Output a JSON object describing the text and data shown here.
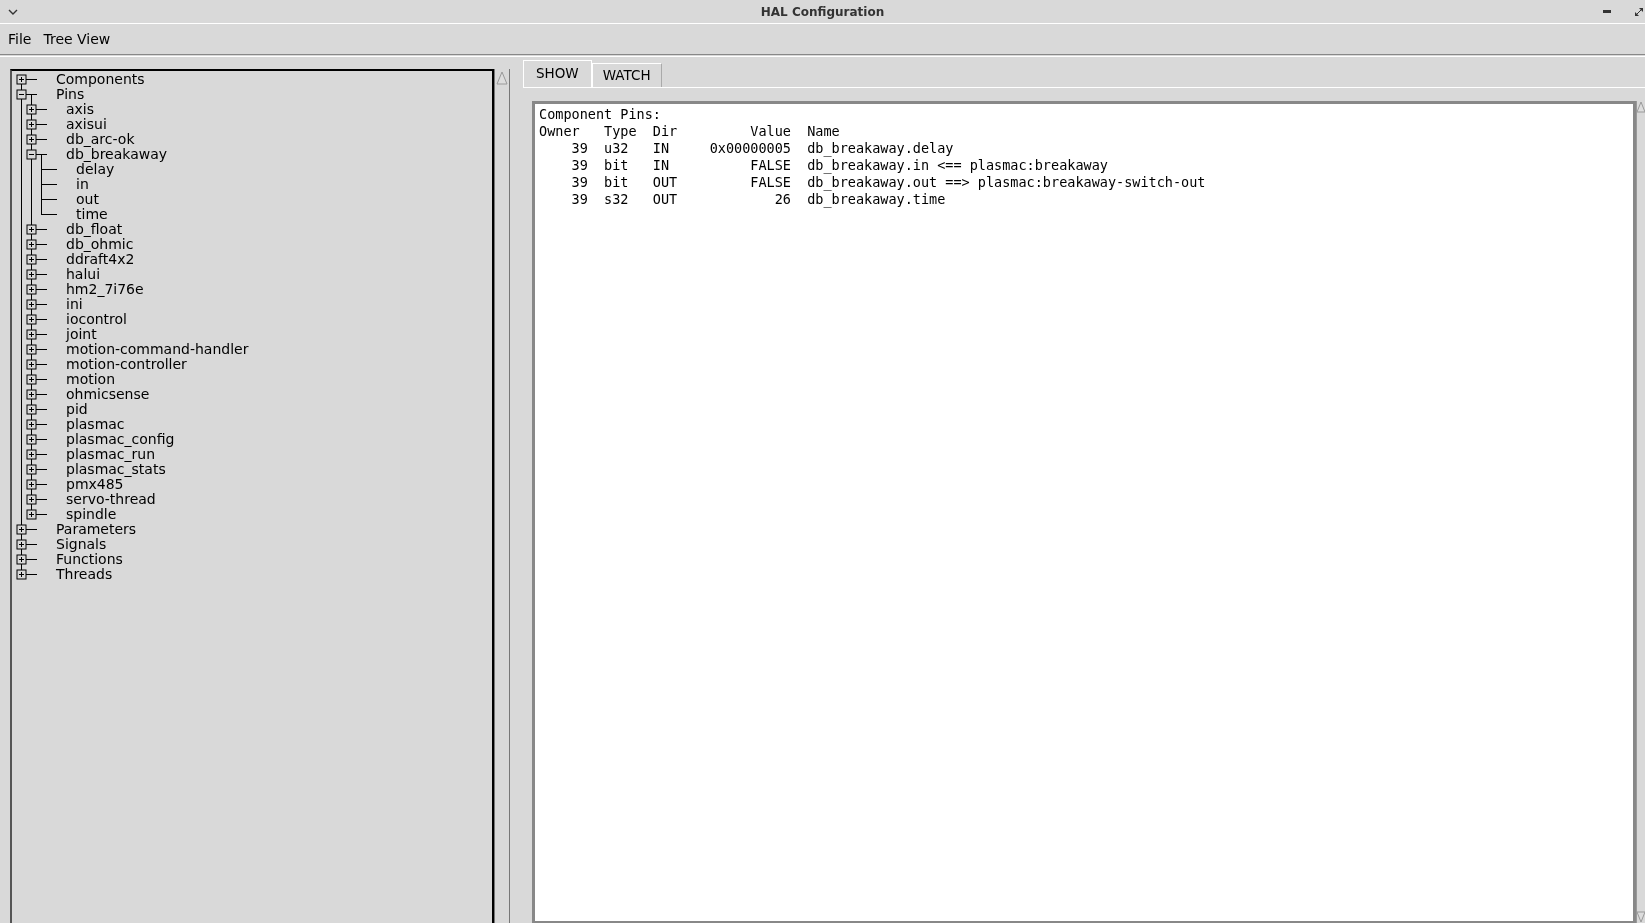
{
  "window": {
    "title": "HAL Configuration"
  },
  "menu": [
    "File",
    "Tree View"
  ],
  "tree": [
    {
      "label": "Components",
      "expanded": false
    },
    {
      "label": "Pins",
      "expanded": true,
      "children": [
        {
          "label": "axis",
          "expanded": false
        },
        {
          "label": "axisui",
          "expanded": false
        },
        {
          "label": "db_arc-ok",
          "expanded": false
        },
        {
          "label": "db_breakaway",
          "expanded": true,
          "children": [
            {
              "label": "delay"
            },
            {
              "label": "in"
            },
            {
              "label": "out"
            },
            {
              "label": "time"
            }
          ]
        },
        {
          "label": "db_float",
          "expanded": false
        },
        {
          "label": "db_ohmic",
          "expanded": false
        },
        {
          "label": "ddraft4x2",
          "expanded": false
        },
        {
          "label": "halui",
          "expanded": false
        },
        {
          "label": "hm2_7i76e",
          "expanded": false
        },
        {
          "label": "ini",
          "expanded": false
        },
        {
          "label": "iocontrol",
          "expanded": false
        },
        {
          "label": "joint",
          "expanded": false
        },
        {
          "label": "motion-command-handler",
          "expanded": false
        },
        {
          "label": "motion-controller",
          "expanded": false
        },
        {
          "label": "motion",
          "expanded": false
        },
        {
          "label": "ohmicsense",
          "expanded": false
        },
        {
          "label": "pid",
          "expanded": false
        },
        {
          "label": "plasmac",
          "expanded": false
        },
        {
          "label": "plasmac_config",
          "expanded": false
        },
        {
          "label": "plasmac_run",
          "expanded": false
        },
        {
          "label": "plasmac_stats",
          "expanded": false
        },
        {
          "label": "pmx485",
          "expanded": false
        },
        {
          "label": "servo-thread",
          "expanded": false
        },
        {
          "label": "spindle",
          "expanded": false
        }
      ]
    },
    {
      "label": "Parameters",
      "expanded": false
    },
    {
      "label": "Signals",
      "expanded": false
    },
    {
      "label": "Functions",
      "expanded": false
    },
    {
      "label": "Threads",
      "expanded": false
    }
  ],
  "tabs": [
    {
      "label": "SHOW",
      "selected": true
    },
    {
      "label": "WATCH",
      "selected": false
    }
  ],
  "output": {
    "heading": "Component Pins:",
    "columns": [
      "Owner",
      "Type",
      "Dir",
      "Value",
      "Name"
    ],
    "rows": [
      [
        "39",
        "u32",
        "IN",
        "0x00000005",
        "db_breakaway.delay"
      ],
      [
        "39",
        "bit",
        "IN",
        "FALSE",
        "db_breakaway.in <== plasmac:breakaway"
      ],
      [
        "39",
        "bit",
        "OUT",
        "FALSE",
        "db_breakaway.out ==> plasmac:breakaway-switch-out"
      ],
      [
        "39",
        "s32",
        "OUT",
        "26",
        "db_breakaway.time"
      ]
    ]
  }
}
